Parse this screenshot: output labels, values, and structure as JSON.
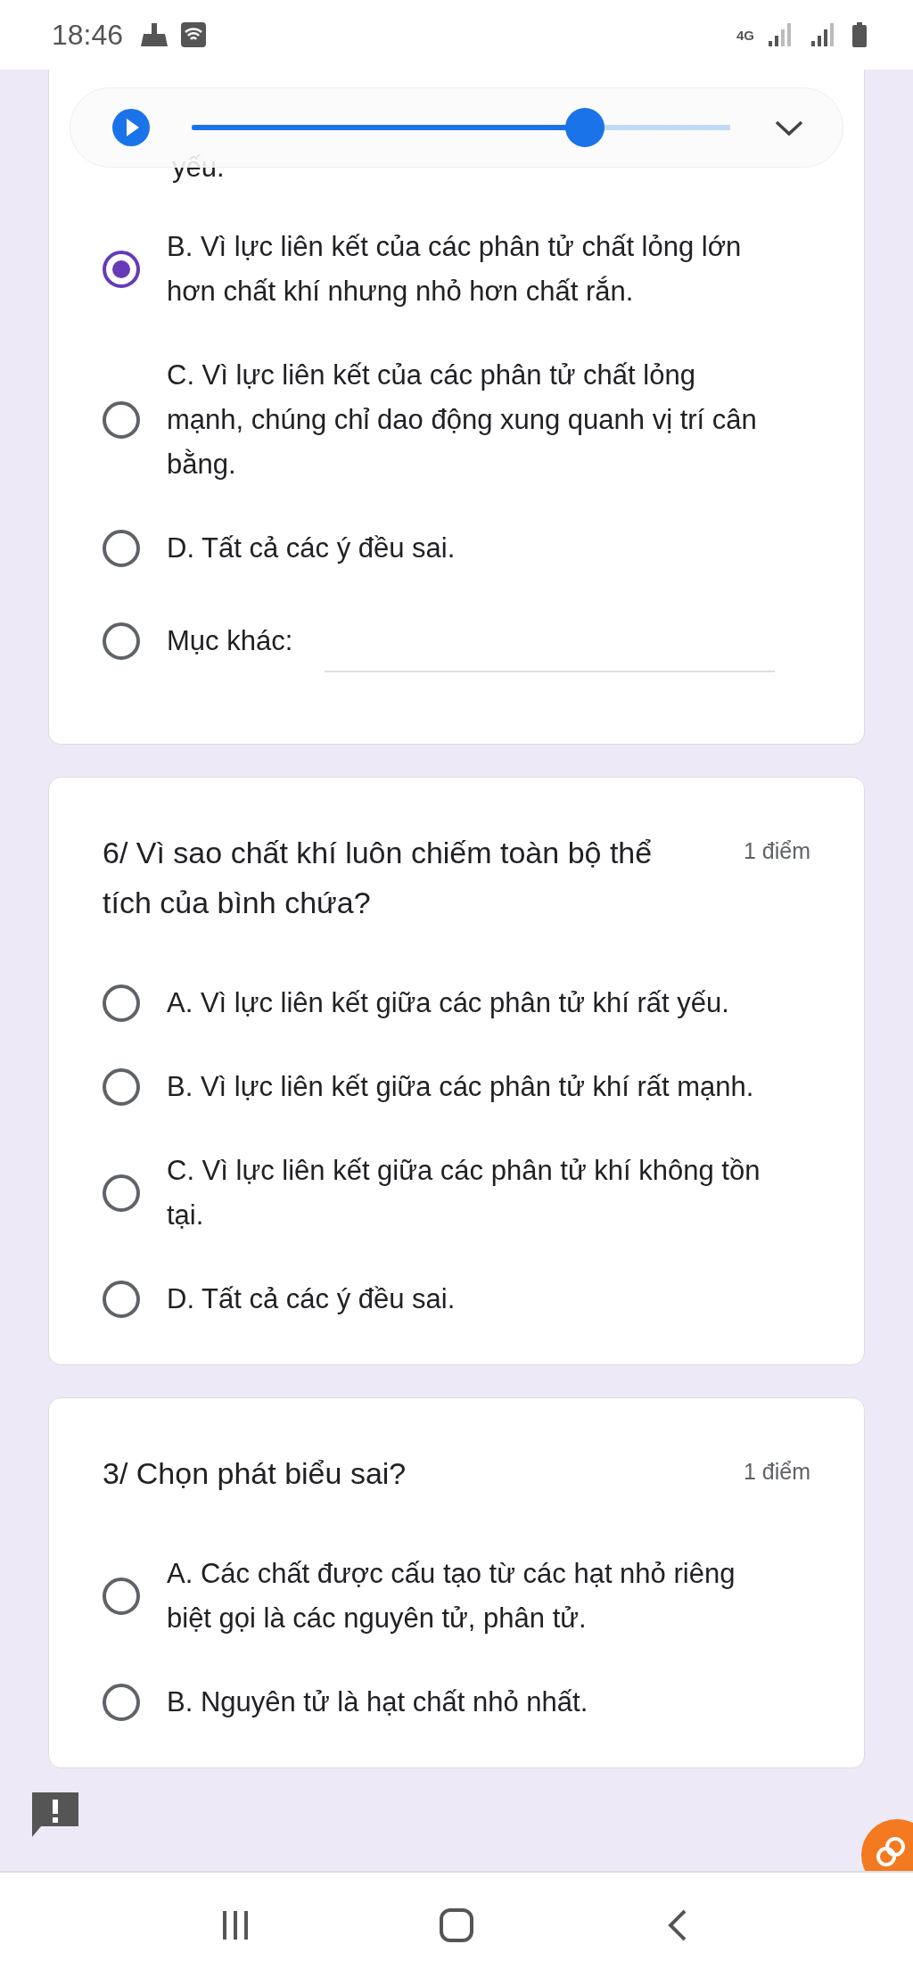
{
  "status_bar": {
    "time": "18:46",
    "network": "4G"
  },
  "audio_player": {
    "level": 0.73
  },
  "questions": [
    {
      "cut_text": "yếu.",
      "options": [
        {
          "label": "B. Vì lực liên kết của các phân tử chất lỏng lớn hơn chất khí nhưng nhỏ hơn chất rắn.",
          "selected": true
        },
        {
          "label": "C. Vì lực liên kết của các phân tử chất lỏng mạnh, chúng chỉ dao động xung quanh vị trí cân bằng.",
          "selected": false
        },
        {
          "label": "D. Tất cả các ý đều sai.",
          "selected": false
        }
      ],
      "other": {
        "label": "Mục khác:",
        "selected": false
      }
    },
    {
      "title": "6/ Vì sao chất khí luôn chiếm toàn bộ thể tích của bình chứa?",
      "points": "1 điểm",
      "options": [
        {
          "label": "A. Vì lực liên kết giữa các phân tử khí rất yếu.",
          "selected": false
        },
        {
          "label": "B. Vì lực liên kết giữa các phân tử khí rất mạnh.",
          "selected": false
        },
        {
          "label": "C. Vì lực liên kết giữa các phân tử khí không tồn tại.",
          "selected": false
        },
        {
          "label": "D. Tất cả các ý đều sai.",
          "selected": false
        }
      ]
    },
    {
      "title": "3/ Chọn phát biểu sai?",
      "points": "1 điểm",
      "options": [
        {
          "label": "A. Các chất được cấu tạo từ các hạt nhỏ riêng biệt gọi là các nguyên tử, phân tử.",
          "selected": false
        },
        {
          "label": "B. Nguyên tử là hạt chất nhỏ nhất.",
          "selected": false
        }
      ]
    }
  ]
}
